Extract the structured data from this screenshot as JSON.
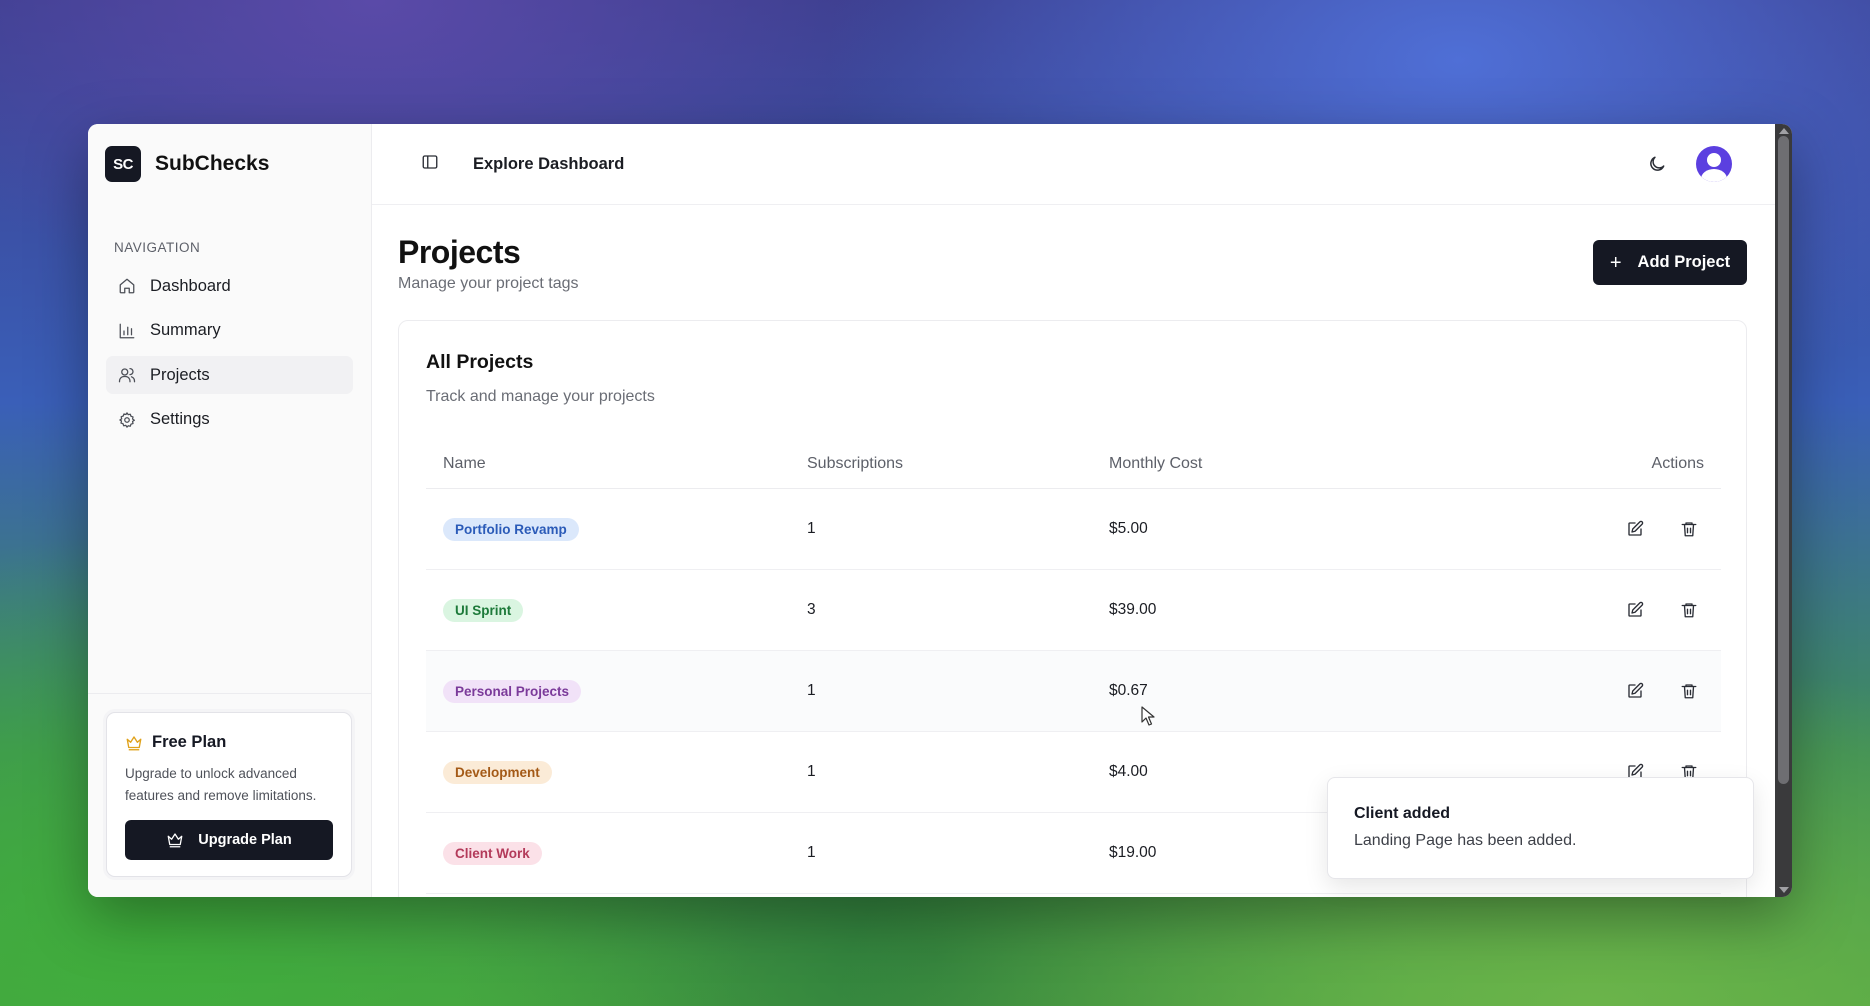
{
  "brand": {
    "logo_text": "SC",
    "name": "SubChecks"
  },
  "sidebar": {
    "section_title": "NAVIGATION",
    "items": [
      {
        "label": "Dashboard",
        "icon": "home-icon",
        "active": false
      },
      {
        "label": "Summary",
        "icon": "bar-chart-icon",
        "active": false
      },
      {
        "label": "Projects",
        "icon": "users-icon",
        "active": true
      },
      {
        "label": "Settings",
        "icon": "gear-icon",
        "active": false
      }
    ],
    "plan": {
      "title": "Free Plan",
      "description": "Upgrade to unlock advanced features and remove limitations.",
      "button_label": "Upgrade Plan"
    }
  },
  "topbar": {
    "breadcrumb": "Explore Dashboard"
  },
  "page": {
    "title": "Projects",
    "subtitle": "Manage your project tags",
    "add_button_label": "Add Project"
  },
  "card": {
    "title": "All Projects",
    "subtitle": "Track and manage your projects"
  },
  "table": {
    "headers": {
      "name": "Name",
      "subscriptions": "Subscriptions",
      "monthly_cost": "Monthly Cost",
      "actions": "Actions"
    },
    "rows": [
      {
        "name": "Portfolio Revamp",
        "subscriptions": "1",
        "monthly_cost": "$5.00",
        "tag_bg": "#dbe8fb",
        "tag_fg": "#2b5bb8"
      },
      {
        "name": "UI Sprint",
        "subscriptions": "3",
        "monthly_cost": "$39.00",
        "tag_bg": "#daf5e1",
        "tag_fg": "#1d7a3a"
      },
      {
        "name": "Personal Projects",
        "subscriptions": "1",
        "monthly_cost": "$0.67",
        "tag_bg": "#f1e2f8",
        "tag_fg": "#7b3a9a"
      },
      {
        "name": "Development",
        "subscriptions": "1",
        "monthly_cost": "$4.00",
        "tag_bg": "#fbebd7",
        "tag_fg": "#a45a17"
      },
      {
        "name": "Client Work",
        "subscriptions": "1",
        "monthly_cost": "$19.00",
        "tag_bg": "#fbe1e8",
        "tag_fg": "#b33a5a"
      }
    ]
  },
  "toast": {
    "title": "Client added",
    "message": "Landing Page has been added."
  }
}
